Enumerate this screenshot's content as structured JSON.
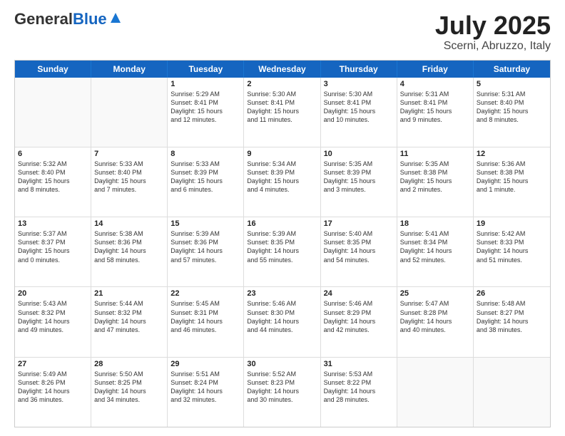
{
  "header": {
    "logo_general": "General",
    "logo_blue": "Blue",
    "month": "July 2025",
    "location": "Scerni, Abruzzo, Italy"
  },
  "weekdays": [
    "Sunday",
    "Monday",
    "Tuesday",
    "Wednesday",
    "Thursday",
    "Friday",
    "Saturday"
  ],
  "rows": [
    [
      {
        "day": "",
        "lines": []
      },
      {
        "day": "",
        "lines": []
      },
      {
        "day": "1",
        "lines": [
          "Sunrise: 5:29 AM",
          "Sunset: 8:41 PM",
          "Daylight: 15 hours",
          "and 12 minutes."
        ]
      },
      {
        "day": "2",
        "lines": [
          "Sunrise: 5:30 AM",
          "Sunset: 8:41 PM",
          "Daylight: 15 hours",
          "and 11 minutes."
        ]
      },
      {
        "day": "3",
        "lines": [
          "Sunrise: 5:30 AM",
          "Sunset: 8:41 PM",
          "Daylight: 15 hours",
          "and 10 minutes."
        ]
      },
      {
        "day": "4",
        "lines": [
          "Sunrise: 5:31 AM",
          "Sunset: 8:41 PM",
          "Daylight: 15 hours",
          "and 9 minutes."
        ]
      },
      {
        "day": "5",
        "lines": [
          "Sunrise: 5:31 AM",
          "Sunset: 8:40 PM",
          "Daylight: 15 hours",
          "and 8 minutes."
        ]
      }
    ],
    [
      {
        "day": "6",
        "lines": [
          "Sunrise: 5:32 AM",
          "Sunset: 8:40 PM",
          "Daylight: 15 hours",
          "and 8 minutes."
        ]
      },
      {
        "day": "7",
        "lines": [
          "Sunrise: 5:33 AM",
          "Sunset: 8:40 PM",
          "Daylight: 15 hours",
          "and 7 minutes."
        ]
      },
      {
        "day": "8",
        "lines": [
          "Sunrise: 5:33 AM",
          "Sunset: 8:39 PM",
          "Daylight: 15 hours",
          "and 6 minutes."
        ]
      },
      {
        "day": "9",
        "lines": [
          "Sunrise: 5:34 AM",
          "Sunset: 8:39 PM",
          "Daylight: 15 hours",
          "and 4 minutes."
        ]
      },
      {
        "day": "10",
        "lines": [
          "Sunrise: 5:35 AM",
          "Sunset: 8:39 PM",
          "Daylight: 15 hours",
          "and 3 minutes."
        ]
      },
      {
        "day": "11",
        "lines": [
          "Sunrise: 5:35 AM",
          "Sunset: 8:38 PM",
          "Daylight: 15 hours",
          "and 2 minutes."
        ]
      },
      {
        "day": "12",
        "lines": [
          "Sunrise: 5:36 AM",
          "Sunset: 8:38 PM",
          "Daylight: 15 hours",
          "and 1 minute."
        ]
      }
    ],
    [
      {
        "day": "13",
        "lines": [
          "Sunrise: 5:37 AM",
          "Sunset: 8:37 PM",
          "Daylight: 15 hours",
          "and 0 minutes."
        ]
      },
      {
        "day": "14",
        "lines": [
          "Sunrise: 5:38 AM",
          "Sunset: 8:36 PM",
          "Daylight: 14 hours",
          "and 58 minutes."
        ]
      },
      {
        "day": "15",
        "lines": [
          "Sunrise: 5:39 AM",
          "Sunset: 8:36 PM",
          "Daylight: 14 hours",
          "and 57 minutes."
        ]
      },
      {
        "day": "16",
        "lines": [
          "Sunrise: 5:39 AM",
          "Sunset: 8:35 PM",
          "Daylight: 14 hours",
          "and 55 minutes."
        ]
      },
      {
        "day": "17",
        "lines": [
          "Sunrise: 5:40 AM",
          "Sunset: 8:35 PM",
          "Daylight: 14 hours",
          "and 54 minutes."
        ]
      },
      {
        "day": "18",
        "lines": [
          "Sunrise: 5:41 AM",
          "Sunset: 8:34 PM",
          "Daylight: 14 hours",
          "and 52 minutes."
        ]
      },
      {
        "day": "19",
        "lines": [
          "Sunrise: 5:42 AM",
          "Sunset: 8:33 PM",
          "Daylight: 14 hours",
          "and 51 minutes."
        ]
      }
    ],
    [
      {
        "day": "20",
        "lines": [
          "Sunrise: 5:43 AM",
          "Sunset: 8:32 PM",
          "Daylight: 14 hours",
          "and 49 minutes."
        ]
      },
      {
        "day": "21",
        "lines": [
          "Sunrise: 5:44 AM",
          "Sunset: 8:32 PM",
          "Daylight: 14 hours",
          "and 47 minutes."
        ]
      },
      {
        "day": "22",
        "lines": [
          "Sunrise: 5:45 AM",
          "Sunset: 8:31 PM",
          "Daylight: 14 hours",
          "and 46 minutes."
        ]
      },
      {
        "day": "23",
        "lines": [
          "Sunrise: 5:46 AM",
          "Sunset: 8:30 PM",
          "Daylight: 14 hours",
          "and 44 minutes."
        ]
      },
      {
        "day": "24",
        "lines": [
          "Sunrise: 5:46 AM",
          "Sunset: 8:29 PM",
          "Daylight: 14 hours",
          "and 42 minutes."
        ]
      },
      {
        "day": "25",
        "lines": [
          "Sunrise: 5:47 AM",
          "Sunset: 8:28 PM",
          "Daylight: 14 hours",
          "and 40 minutes."
        ]
      },
      {
        "day": "26",
        "lines": [
          "Sunrise: 5:48 AM",
          "Sunset: 8:27 PM",
          "Daylight: 14 hours",
          "and 38 minutes."
        ]
      }
    ],
    [
      {
        "day": "27",
        "lines": [
          "Sunrise: 5:49 AM",
          "Sunset: 8:26 PM",
          "Daylight: 14 hours",
          "and 36 minutes."
        ]
      },
      {
        "day": "28",
        "lines": [
          "Sunrise: 5:50 AM",
          "Sunset: 8:25 PM",
          "Daylight: 14 hours",
          "and 34 minutes."
        ]
      },
      {
        "day": "29",
        "lines": [
          "Sunrise: 5:51 AM",
          "Sunset: 8:24 PM",
          "Daylight: 14 hours",
          "and 32 minutes."
        ]
      },
      {
        "day": "30",
        "lines": [
          "Sunrise: 5:52 AM",
          "Sunset: 8:23 PM",
          "Daylight: 14 hours",
          "and 30 minutes."
        ]
      },
      {
        "day": "31",
        "lines": [
          "Sunrise: 5:53 AM",
          "Sunset: 8:22 PM",
          "Daylight: 14 hours",
          "and 28 minutes."
        ]
      },
      {
        "day": "",
        "lines": []
      },
      {
        "day": "",
        "lines": []
      }
    ]
  ]
}
